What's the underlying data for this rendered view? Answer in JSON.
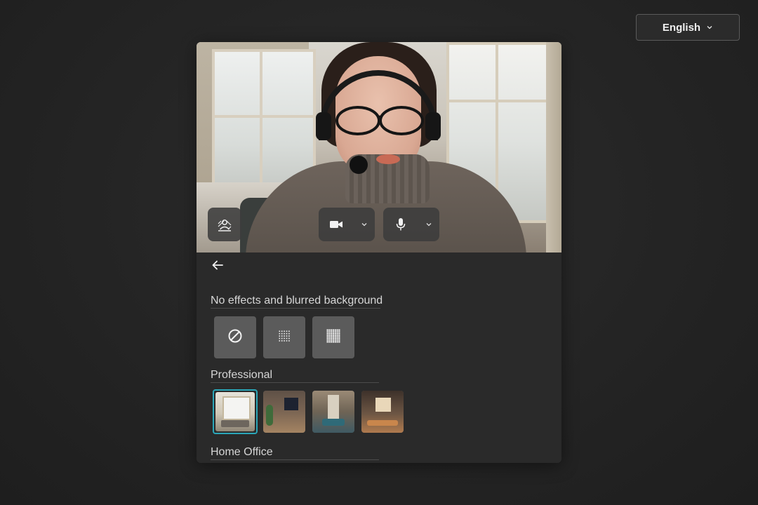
{
  "language_selector": {
    "label": "English",
    "icon": "chevron-down-icon"
  },
  "preview": {
    "controls": {
      "effects": {
        "icon": "background-effects-icon"
      },
      "camera": {
        "icon": "video-camera-icon",
        "dropdown_icon": "chevron-down-icon"
      },
      "microphone": {
        "icon": "microphone-icon",
        "dropdown_icon": "chevron-down-icon"
      }
    }
  },
  "effects_panel": {
    "back_icon": "arrow-left-icon",
    "sections": [
      {
        "title": "No effects and blurred background",
        "options": [
          {
            "icon": "no-effect-icon"
          },
          {
            "icon": "blur-light-icon"
          },
          {
            "icon": "blur-strong-icon"
          }
        ]
      },
      {
        "title": "Professional",
        "options": [
          {
            "icon": "office-background-thumbnail",
            "selected": true
          },
          {
            "icon": "office-background-thumbnail",
            "selected": false
          },
          {
            "icon": "office-background-thumbnail",
            "selected": false
          },
          {
            "icon": "office-background-thumbnail",
            "selected": false
          }
        ]
      },
      {
        "title": "Home Office",
        "options": []
      }
    ]
  },
  "colors": {
    "background": "#242424",
    "card": "#2a2a2a",
    "tile": "#5b5b5b",
    "selected_border": "#2aa6b8",
    "control": "#3c3c3c"
  }
}
